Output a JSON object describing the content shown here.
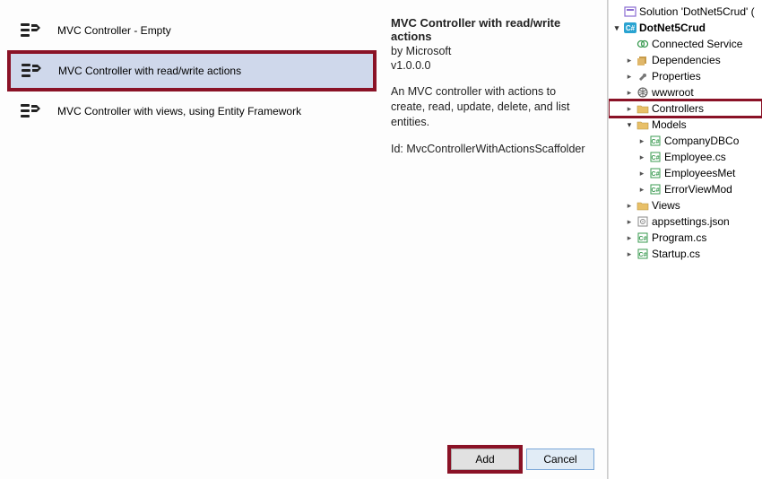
{
  "scaffold": {
    "items": [
      {
        "label": "MVC Controller - Empty"
      },
      {
        "label": "MVC Controller with read/write actions"
      },
      {
        "label": "MVC Controller with views, using Entity Framework"
      }
    ],
    "selected_index": 1
  },
  "description": {
    "title": "MVC Controller with read/write actions",
    "by": "by Microsoft",
    "version": "v1.0.0.0",
    "body": "An MVC controller with actions to create, read, update, delete, and list entities.",
    "id_label": "Id: MvcControllerWithActionsScaffolder"
  },
  "footer": {
    "add_label": "Add",
    "cancel_label": "Cancel"
  },
  "solution": {
    "root": "Solution 'DotNet5Crud' (",
    "project": "DotNet5Crud",
    "nodes": {
      "connected": "Connected Service",
      "deps": "Dependencies",
      "props": "Properties",
      "wwwroot": "wwwroot",
      "controllers": "Controllers",
      "models": "Models",
      "model_items": [
        "CompanyDBCo",
        "Employee.cs",
        "EmployeesMet",
        "ErrorViewMod"
      ],
      "views": "Views",
      "appsettings": "appsettings.json",
      "program": "Program.cs",
      "startup": "Startup.cs"
    }
  }
}
